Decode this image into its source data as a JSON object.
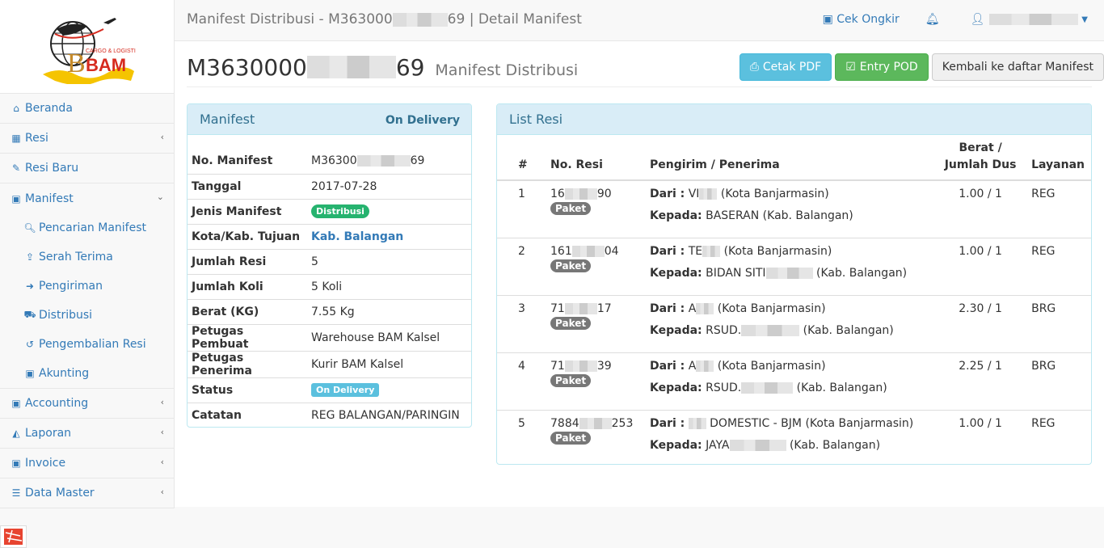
{
  "app": {
    "logo_text": "BAM",
    "logo_tagline": "CARGO & LOGISTIC"
  },
  "sidebar": {
    "items": [
      {
        "label": "Beranda",
        "icon": "home-icon"
      },
      {
        "label": "Resi",
        "icon": "table-icon",
        "has_children": true
      },
      {
        "label": "Resi Baru",
        "icon": "edit-icon"
      },
      {
        "label": "Manifest",
        "icon": "money-icon",
        "expanded": true,
        "children": [
          {
            "label": "Pencarian Manifest",
            "icon": "search-icon"
          },
          {
            "label": "Serah Terima",
            "icon": "upload-icon"
          },
          {
            "label": "Pengiriman",
            "icon": "share-icon"
          },
          {
            "label": "Distribusi",
            "icon": "truck-icon"
          },
          {
            "label": "Pengembalian Resi",
            "icon": "undo-icon"
          },
          {
            "label": "Akunting",
            "icon": "money-icon"
          }
        ]
      },
      {
        "label": "Accounting",
        "icon": "money-icon",
        "has_children": true
      },
      {
        "label": "Laporan",
        "icon": "area-chart-icon",
        "has_children": true
      },
      {
        "label": "Invoice",
        "icon": "money-icon",
        "has_children": true
      },
      {
        "label": "Data Master",
        "icon": "database-icon",
        "has_children": true
      }
    ]
  },
  "topbar": {
    "title_prefix": "Manifest Distribusi - M363000",
    "title_suffix": "69 | Detail Manifest",
    "cek_ongkir": "Cek Ongkir",
    "user_name": ""
  },
  "header": {
    "title_prefix": "M3630000",
    "title_suffix": "69",
    "subtitle": "Manifest Distribusi",
    "buttons": {
      "cetak_pdf": "Cetak PDF",
      "entry_pod": "Entry POD",
      "kembali": "Kembali ke daftar Manifest"
    }
  },
  "manifest_panel": {
    "title": "Manifest",
    "status_heading": "On Delivery",
    "rows": [
      {
        "key": "No. Manifest",
        "value_prefix": "M36300",
        "value_suffix": "69"
      },
      {
        "key": "Tanggal",
        "value": "2017-07-28"
      },
      {
        "key": "Jenis Manifest",
        "value": "Distribusi",
        "type": "badge"
      },
      {
        "key": "Kota/Kab. Tujuan",
        "value": "Kab. Balangan",
        "type": "link"
      },
      {
        "key": "Jumlah Resi",
        "value": "5"
      },
      {
        "key": "Jumlah Koli",
        "value": "5 Koli"
      },
      {
        "key": "Berat (KG)",
        "value": "7.55 Kg"
      },
      {
        "key": "Petugas Pembuat",
        "value": "Warehouse BAM Kalsel"
      },
      {
        "key": "Petugas Penerima",
        "value": "Kurir BAM Kalsel"
      },
      {
        "key": "Status",
        "value": "On Delivery",
        "type": "label"
      },
      {
        "key": "Catatan",
        "value": "REG BALANGAN/PARINGIN"
      }
    ]
  },
  "list_panel": {
    "title": "List Resi",
    "columns": [
      "#",
      "No. Resi",
      "Pengirim / Penerima",
      "Berat /",
      "Jumlah Dus",
      "Layanan"
    ],
    "dari_label": "Dari :",
    "kepada_label": "Kepada:",
    "rows": [
      {
        "no": "1",
        "resi_prefix": "16",
        "resi_suffix": "90",
        "type": "Paket",
        "dari_prefix": "VI",
        "dari_suffix": "(Kota Banjarmasin)",
        "kepada_prefix": "BASERAN",
        "kepada_suffix": "(Kab. Balangan)",
        "berat": "1.00 / 1",
        "layanan": "REG"
      },
      {
        "no": "2",
        "resi_prefix": "161",
        "resi_suffix": "04",
        "type": "Paket",
        "dari_prefix": "TE",
        "dari_suffix": "(Kota Banjarmasin)",
        "kepada_prefix": "BIDAN SITI",
        "kepada_suffix": "(Kab. Balangan)",
        "berat": "1.00 / 1",
        "layanan": "REG"
      },
      {
        "no": "3",
        "resi_prefix": "71",
        "resi_suffix": "17",
        "type": "Paket",
        "dari_prefix": "A",
        "dari_suffix": "(Kota Banjarmasin)",
        "kepada_prefix": "RSUD.",
        "kepada_suffix": "(Kab. Balangan)",
        "berat": "2.30 / 1",
        "layanan": "BRG"
      },
      {
        "no": "4",
        "resi_prefix": "71",
        "resi_suffix": "39",
        "type": "Paket",
        "dari_prefix": "A",
        "dari_suffix": "(Kota Banjarmasin)",
        "kepada_prefix": "RSUD.",
        "kepada_suffix": "(Kab. Balangan)",
        "berat": "2.25 / 1",
        "layanan": "BRG"
      },
      {
        "no": "5",
        "resi_prefix": "7884",
        "resi_suffix": "253",
        "type": "Paket",
        "dari_prefix": "",
        "dari_suffix": "DOMESTIC - BJM (Kota Banjarmasin)",
        "kepada_prefix": "JAYA",
        "kepada_suffix": "(Kab. Balangan)",
        "berat": "1.00 / 1",
        "layanan": "REG"
      }
    ]
  },
  "colors": {
    "primary": "#337ab7",
    "info": "#5bc0de",
    "success": "#5cb85c",
    "badge_green": "#26b36f",
    "panel_heading": "#d9edf7"
  }
}
